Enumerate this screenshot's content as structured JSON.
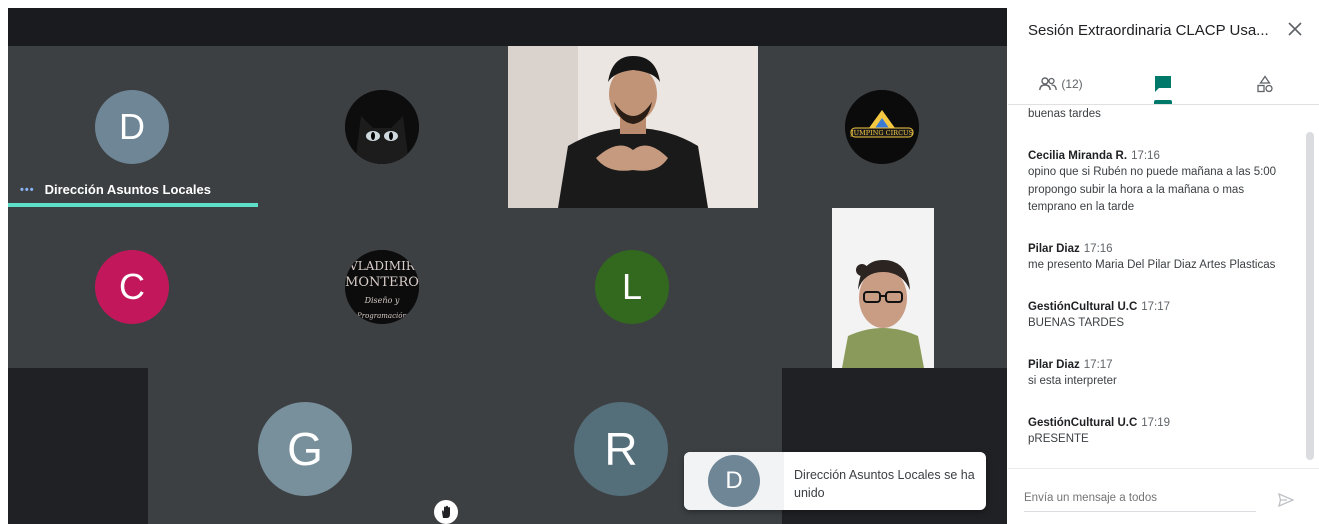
{
  "panel": {
    "title": "Sesión Extraordinaria CLACP Usa...",
    "people_count": "(12)",
    "compose_placeholder": "Envía un mensaje a todos"
  },
  "stage": {
    "speaker_name": "Dirección Asuntos Locales",
    "avatars": {
      "d": "D",
      "c": "C",
      "l": "L",
      "g": "G",
      "r": "R"
    },
    "avatar_colors": {
      "d": "#6f8697",
      "c": "#c2185b",
      "l": "#33691e",
      "g": "#78909c",
      "r": "#546e7a"
    },
    "vladimir_logo": [
      "VLADIMIR",
      "MONTERO",
      "Diseño y",
      "Programación"
    ],
    "circus_logo": "JUMPING CIRCUS"
  },
  "toast": {
    "avatar": "D",
    "text": "Dirección Asuntos Locales se ha unido"
  },
  "messages": [
    {
      "sender": "",
      "time": "",
      "lines": [
        "buenas tardes"
      ]
    },
    {
      "sender": "Cecilia Miranda R.",
      "time": "17:16",
      "lines": [
        "opino que si Rubén no puede mañana a las 5:00",
        "propongo subir la hora a la mañana o mas",
        "temprano en la tarde"
      ]
    },
    {
      "sender": "Pilar Diaz",
      "time": "17:16",
      "lines": [
        "me presento Maria Del Pilar Diaz Artes Plasticas"
      ]
    },
    {
      "sender": "GestiónCultural U.C",
      "time": "17:17",
      "lines": [
        "BUENAS TARDES"
      ]
    },
    {
      "sender": "Pilar Diaz",
      "time": "17:17",
      "lines": [
        "si esta interpreter"
      ]
    },
    {
      "sender": "GestiónCultural U.C",
      "time": "17:19",
      "lines": [
        "pRESENTE"
      ]
    }
  ],
  "icons": {
    "people": "people-icon",
    "chat": "chat-icon",
    "activities": "activities-icon",
    "close": "close-icon",
    "send": "send-icon",
    "hand": "raise-hand-icon"
  },
  "colors": {
    "accent": "#00796b",
    "speaking": "#5de0c7"
  }
}
